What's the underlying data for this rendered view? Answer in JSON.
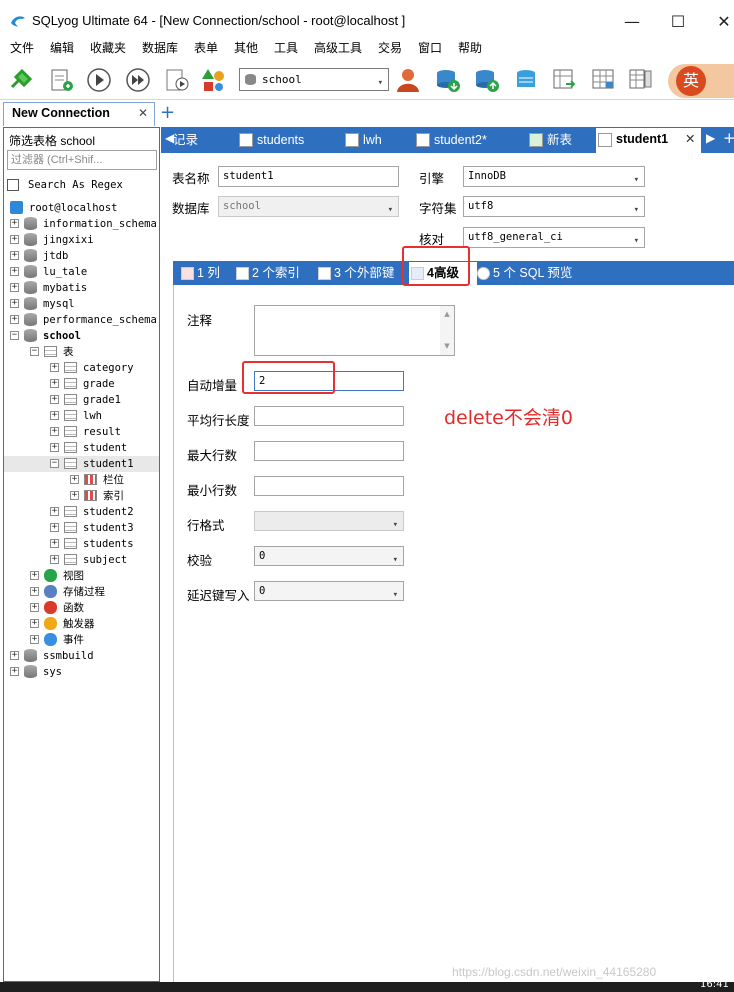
{
  "window": {
    "title": "SQLyog Ultimate 64 - [New Connection/school - root@localhost ]",
    "minimize": "—",
    "maximize": "☐",
    "close": "✕"
  },
  "menu": [
    "文件",
    "编辑",
    "收藏夹",
    "数据库",
    "表单",
    "其他",
    "工具",
    "高级工具",
    "交易",
    "窗口",
    "帮助"
  ],
  "toolbar": {
    "database_select": "school",
    "logo_text": "英"
  },
  "connection_tab": {
    "label": "New Connection",
    "close": "✕",
    "add": "+"
  },
  "sidebar": {
    "filter_label": "筛选表格 school",
    "filter_placeholder": "过滤器 (Ctrl+Shif...",
    "regex_label": "Search As Regex",
    "root": "root@localhost",
    "databases_top": [
      "information_schema",
      "jingxixi",
      "jtdb",
      "lu_tale",
      "mybatis",
      "mysql",
      "performance_schema"
    ],
    "active_db": "school",
    "tables_folder": "表",
    "tables": [
      "category",
      "grade",
      "grade1",
      "lwh",
      "result",
      "student",
      "student1"
    ],
    "student1_children": [
      "栏位",
      "索引"
    ],
    "tables_after": [
      "student2",
      "student3",
      "students",
      "subject"
    ],
    "folders": [
      "视图",
      "存储过程",
      "函数",
      "触发器",
      "事件"
    ],
    "databases_bottom": [
      "ssmbuild",
      "sys"
    ]
  },
  "doc_tabs": {
    "items": [
      "记录",
      "students",
      "lwh",
      "student2*",
      "新表",
      "student1"
    ],
    "active": "student1",
    "close": "✕"
  },
  "form": {
    "table_name_label": "表名称",
    "table_name": "student1",
    "database_label": "数据库",
    "database": "school",
    "engine_label": "引擎",
    "engine": "InnoDB",
    "charset_label": "字符集",
    "charset": "utf8",
    "collation_label": "核对",
    "collation": "utf8_general_ci"
  },
  "sub_tabs": [
    "1 列",
    "2 个索引",
    "3 个外部键",
    "4高级",
    "5 个 SQL 预览"
  ],
  "advanced": {
    "comment_label": "注释",
    "auto_increment_label": "自动增量",
    "auto_increment": "2",
    "avg_row_length_label": "平均行长度",
    "max_rows_label": "最大行数",
    "min_rows_label": "最小行数",
    "row_format_label": "行格式",
    "checksum_label": "校验",
    "checksum": "0",
    "delay_key_write_label": "延迟键写入",
    "delay_key_write": "0"
  },
  "annotation": "delete不会清0",
  "watermark": "https://blog.csdn.net/weixin_44165280",
  "clock": "16:41",
  "colors": {
    "accent": "#2f6fbf",
    "annotation": "#e52a2a"
  }
}
